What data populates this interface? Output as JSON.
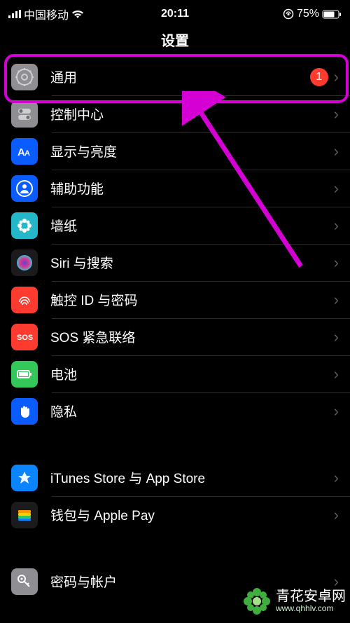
{
  "status": {
    "carrier": "中国移动",
    "time": "20:11",
    "battery": "75%"
  },
  "title": "设置",
  "sections": [
    {
      "rows": [
        {
          "id": "general",
          "label": "通用",
          "badge": "1",
          "icon": "gear",
          "color": "#8e8e93"
        },
        {
          "id": "control-center",
          "label": "控制中心",
          "icon": "switches",
          "color": "#8e8e93"
        },
        {
          "id": "display",
          "label": "显示与亮度",
          "icon": "aa",
          "color": "#0a5cff"
        },
        {
          "id": "accessibility",
          "label": "辅助功能",
          "icon": "person",
          "color": "#0a5cff"
        },
        {
          "id": "wallpaper",
          "label": "墙纸",
          "icon": "flower",
          "color": "#23b7c9"
        },
        {
          "id": "siri",
          "label": "Siri 与搜索",
          "icon": "siri",
          "color": "#1b1b1d"
        },
        {
          "id": "touchid",
          "label": "触控 ID 与密码",
          "icon": "fingerprint",
          "color": "#ff3b30"
        },
        {
          "id": "sos",
          "label": "SOS 紧急联络",
          "icon": "sos",
          "color": "#ff3b30"
        },
        {
          "id": "battery",
          "label": "电池",
          "icon": "battery",
          "color": "#34c759"
        },
        {
          "id": "privacy",
          "label": "隐私",
          "icon": "hand",
          "color": "#0a5cff"
        }
      ]
    },
    {
      "rows": [
        {
          "id": "appstore",
          "label": "iTunes Store 与 App Store",
          "icon": "appstore",
          "color": "#0a84ff"
        },
        {
          "id": "wallet",
          "label": "钱包与 Apple Pay",
          "icon": "wallet",
          "color": "#1b1b1d"
        }
      ]
    },
    {
      "rows": [
        {
          "id": "passwords",
          "label": "密码与帐户",
          "icon": "key",
          "color": "#8e8e93"
        }
      ]
    }
  ],
  "watermark": {
    "line1": "青花安卓网",
    "line2": "www.qhhlv.com"
  }
}
